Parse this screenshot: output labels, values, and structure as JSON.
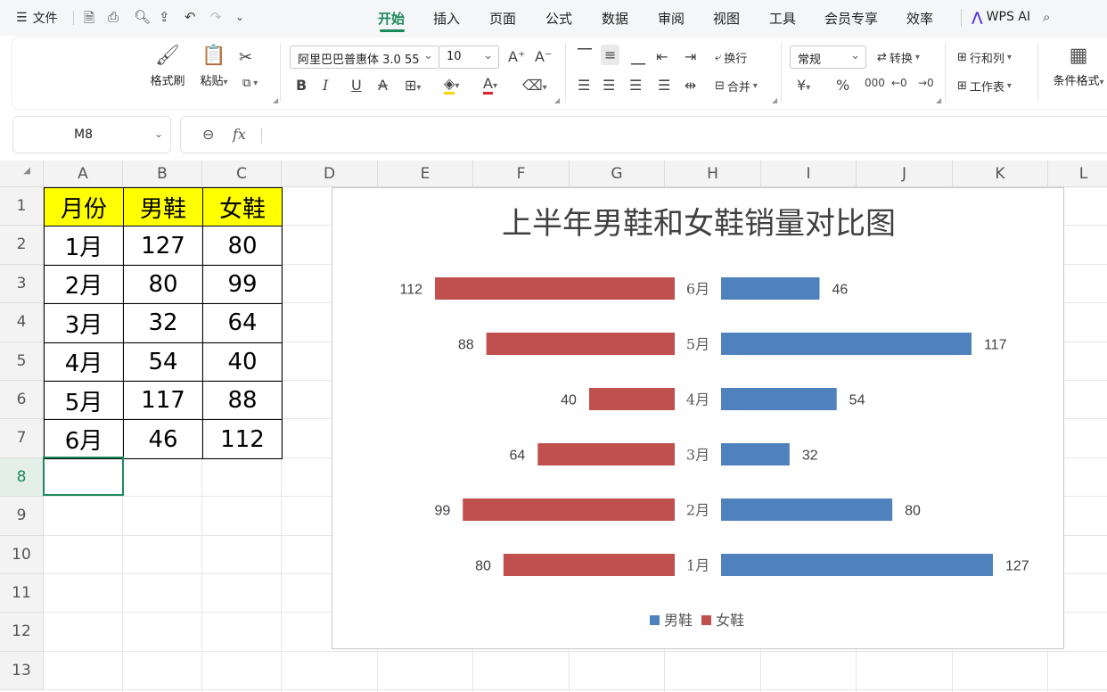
{
  "menubar": {
    "file_label": "文件",
    "tabs": [
      "开始",
      "插入",
      "页面",
      "公式",
      "数据",
      "审阅",
      "视图",
      "工具",
      "会员专享",
      "效率"
    ],
    "active_tab": "开始",
    "ai_label": "WPS AI"
  },
  "ribbon": {
    "format_painter": "格式刷",
    "paste": "粘贴",
    "font_name": "阿里巴巴普惠体 3.0 55",
    "font_size": "10",
    "wrap": "换行",
    "merge": "合并",
    "number_format": "常规",
    "convert": "转换",
    "rows_cols": "行和列",
    "worksheet": "工作表",
    "conditional_format": "条件格式"
  },
  "formula_bar": {
    "name_box": "M8",
    "fx_label": "fx",
    "content": ""
  },
  "columns": [
    "A",
    "B",
    "C",
    "D",
    "E",
    "F",
    "G",
    "H",
    "I",
    "J",
    "K",
    "L"
  ],
  "rows": [
    "1",
    "2",
    "3",
    "4",
    "5",
    "6",
    "7",
    "8",
    "9",
    "10",
    "11",
    "12",
    "13"
  ],
  "selected_cell": "M8",
  "table": {
    "headers": [
      "月份",
      "男鞋",
      "女鞋"
    ],
    "rows": [
      [
        "1月",
        "127",
        "80"
      ],
      [
        "2月",
        "80",
        "99"
      ],
      [
        "3月",
        "32",
        "64"
      ],
      [
        "4月",
        "54",
        "40"
      ],
      [
        "5月",
        "117",
        "88"
      ],
      [
        "6月",
        "46",
        "112"
      ]
    ],
    "header_fill": "#ffff00"
  },
  "chart_data": {
    "type": "bar",
    "orientation": "horizontal-butterfly",
    "title": "上半年男鞋和女鞋销量对比图",
    "categories": [
      "1月",
      "2月",
      "3月",
      "4月",
      "5月",
      "6月"
    ],
    "series": [
      {
        "name": "男鞋",
        "values": [
          127,
          80,
          32,
          54,
          117,
          46
        ],
        "color": "#4f81bd",
        "side": "right"
      },
      {
        "name": "女鞋",
        "values": [
          80,
          99,
          64,
          40,
          88,
          112
        ],
        "color": "#c0504d",
        "side": "left"
      }
    ],
    "data_labels": true,
    "legend": "bottom",
    "grid": false
  },
  "colors": {
    "accent": "#1b8a5a"
  }
}
